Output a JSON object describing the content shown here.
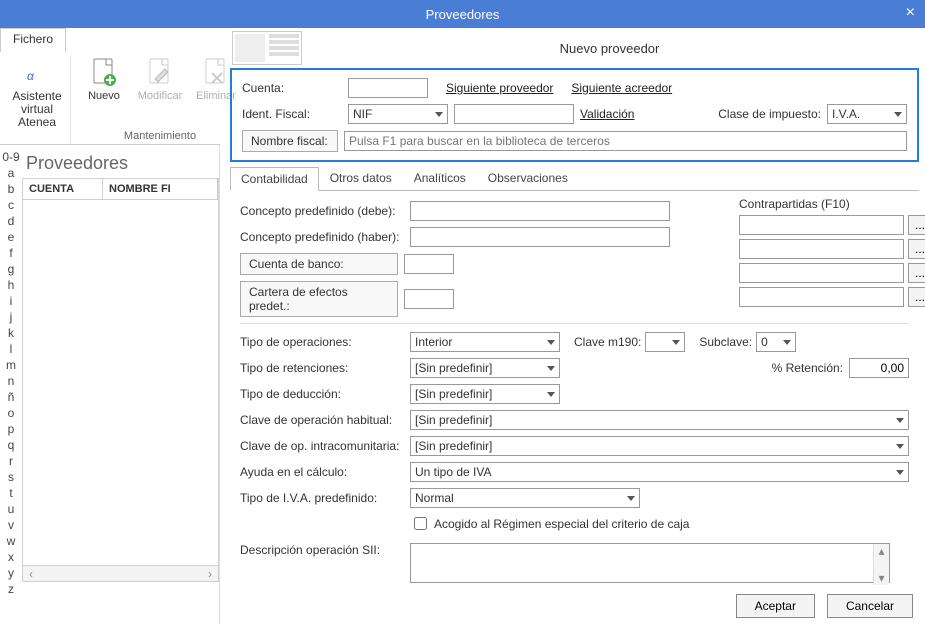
{
  "window": {
    "title": "Proveedores"
  },
  "ribbon": {
    "tab": "Fichero",
    "group1_title": "",
    "group2_title": "Mantenimiento",
    "btn_asistente_l1": "Asistente",
    "btn_asistente_l2": "virtual",
    "btn_asistente_l3": "Atenea",
    "btn_nuevo": "Nuevo",
    "btn_modificar": "Modificar",
    "btn_eliminar": "Eliminar"
  },
  "alpha": [
    "0-9",
    "a",
    "b",
    "c",
    "d",
    "e",
    "f",
    "g",
    "h",
    "i",
    "j",
    "k",
    "l",
    "m",
    "n",
    "ñ",
    "o",
    "p",
    "q",
    "r",
    "s",
    "t",
    "u",
    "v",
    "w",
    "x",
    "y",
    "z"
  ],
  "listpanel": {
    "heading": "Proveedores",
    "col_cuenta": "CUENTA",
    "col_nombre": "NOMBRE FI"
  },
  "dialog": {
    "title": "Nuevo proveedor",
    "cuenta_lbl": "Cuenta:",
    "siguiente_proveedor": "Siguiente proveedor",
    "siguiente_acreedor": "Siguiente acreedor",
    "ident_fiscal_lbl": "Ident. Fiscal:",
    "nif_value": "NIF",
    "validacion": "Validación",
    "clase_impuesto_lbl": "Clase de impuesto:",
    "clase_impuesto_value": "I.V.A.",
    "nombre_fiscal_btn": "Nombre fiscal:",
    "nombre_fiscal_placeholder": "Pulsa F1 para buscar en la biblioteca de terceros",
    "tabs": {
      "contabilidad": "Contabilidad",
      "otros": "Otros datos",
      "analiticos": "Analíticos",
      "observaciones": "Observaciones"
    },
    "contab": {
      "concepto_debe": "Concepto predefinido (debe):",
      "concepto_haber": "Concepto predefinido (haber):",
      "cuenta_banco": "Cuenta de banco:",
      "cartera_efectos": "Cartera de efectos predet.:",
      "contrapartidas": "Contrapartidas (F10)",
      "ellipsis": "...",
      "tipo_operaciones": "Tipo de operaciones:",
      "tipo_operaciones_val": "Interior",
      "clave_m190": "Clave m190:",
      "subclave": "Subclave:",
      "subclave_val": "0",
      "tipo_retenciones": "Tipo de retenciones:",
      "sin_predefinir": "[Sin predefinir]",
      "pct_retencion": "% Retención:",
      "pct_retencion_val": "0,00",
      "tipo_deduccion": "Tipo de deducción:",
      "clave_op_habitual": "Clave de operación habitual:",
      "clave_op_intracom": "Clave de op. intracomunitaria:",
      "ayuda_calculo": "Ayuda en el cálculo:",
      "ayuda_calculo_val": "Un tipo de IVA",
      "tipo_iva_predef": "Tipo de I.V.A. predefinido:",
      "tipo_iva_predef_val": "Normal",
      "acogido_regimen": "Acogido al Régimen especial del criterio de caja",
      "desc_op_sii": "Descripción operación SII:"
    },
    "footer": {
      "aceptar": "Aceptar",
      "cancelar": "Cancelar"
    }
  }
}
